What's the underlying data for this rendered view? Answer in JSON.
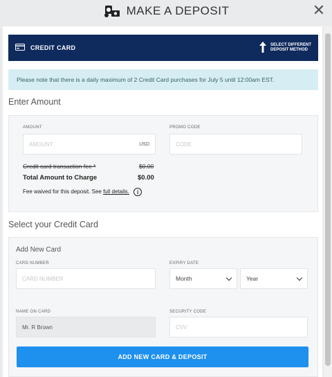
{
  "header": {
    "title": "MAKE A DEPOSIT",
    "icon": "money-icon",
    "close_icon": "close-icon"
  },
  "payment_method": {
    "label": "CREDIT CARD",
    "switch_line1": "SELECT DIFFERENT",
    "switch_line2": "DEPOSIT METHOD"
  },
  "notice": "Please note that there is a daily maximum of 2 Credit Card purchases for July 5 until 12:00am EST.",
  "enter_amount": {
    "title": "Enter Amount",
    "amount_label": "AMOUNT",
    "amount_placeholder": "AMOUNT",
    "currency": "USD",
    "promo_label": "PROMO CODE",
    "promo_placeholder": "CODE",
    "fee_label": "Credit card transaction fee *",
    "fee_value": "$0.00",
    "total_label": "Total Amount to Charge",
    "total_value": "$0.00",
    "waived_text": "Fee waived for this deposit. See",
    "waived_link": "full details."
  },
  "credit_card": {
    "title": "Select your Credit Card",
    "subtitle": "Add New Card",
    "card_number_label": "CARD NUMBER",
    "card_number_placeholder": "CARD NUMBER",
    "expiry_label": "EXPIRY DATE",
    "month": "Month",
    "year": "Year",
    "name_label": "NAME ON CARD",
    "name_value": "Mr. R Brown",
    "security_label": "SECURITY CODE",
    "cvv_placeholder": "CVV",
    "submit": "ADD NEW CARD & DEPOSIT"
  },
  "colors": {
    "navy": "#0f2a5c",
    "primary": "#1e90ee",
    "notice_bg": "#d6eef3"
  }
}
